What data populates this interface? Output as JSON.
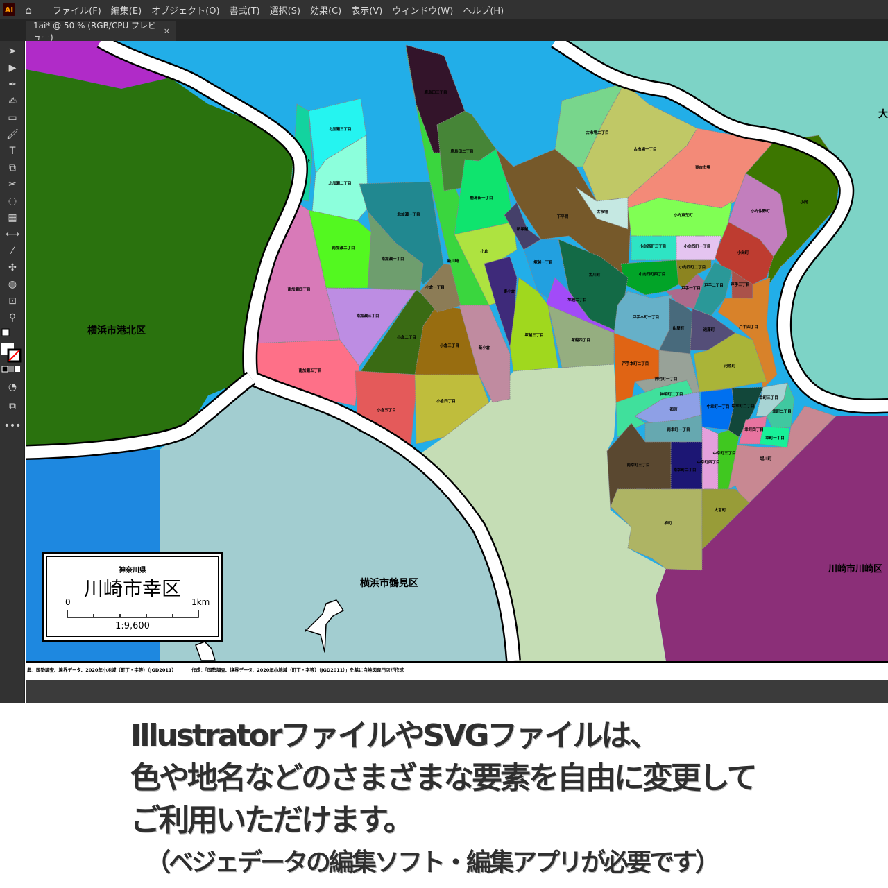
{
  "app": {
    "logo": "Ai",
    "home_icon": "home-icon"
  },
  "menu": [
    "ファイル(F)",
    "編集(E)",
    "オブジェクト(O)",
    "書式(T)",
    "選択(S)",
    "効果(C)",
    "表示(V)",
    "ウィンドウ(W)",
    "ヘルプ(H)"
  ],
  "tab": {
    "title": "1ai* @ 50 % (RGB/CPU プレビュー)",
    "close": "×"
  },
  "tools": [
    "selection",
    "direct-selection",
    "pen",
    "curvature",
    "rectangle",
    "paintbrush",
    "type",
    "scale",
    "scissors",
    "lasso",
    "gradient",
    "width",
    "eyedropper",
    "puppet-warp",
    "shape-builder",
    "artboard",
    "zoom"
  ],
  "map": {
    "areas": {
      "kohoku": "横浜市港北区",
      "tsurumi": "横浜市鶴見区",
      "kawasaki": "川崎市川崎区",
      "ota": "大"
    },
    "colors": {
      "sea": "#22aee8",
      "purple_tl": "#b02bc8",
      "kohoku": "#2a720e",
      "tsurumi_a": "#1e88e0",
      "tsurumi_b": "#a2cdd0",
      "kawasaki_green": "#c5ddb5",
      "kawasaki_ku": "#8b2f78",
      "ota": "#7dd3c6"
    },
    "districts": [
      {
        "name": "矢上",
        "color": "#13d39f"
      },
      {
        "name": "北加瀬三丁目",
        "color": "#25f4f0"
      },
      {
        "name": "北加瀬二丁目",
        "color": "#8cffdc"
      },
      {
        "name": "北加瀬一丁目",
        "color": "#218890"
      },
      {
        "name": "南加瀬二丁目",
        "color": "#53f820"
      },
      {
        "name": "南加瀬一丁目",
        "color": "#6e9e6e"
      },
      {
        "name": "南加瀬四丁目",
        "color": "#d87ab8"
      },
      {
        "name": "南加瀬三丁目",
        "color": "#bd8de3"
      },
      {
        "name": "南加瀬五丁目",
        "color": "#fe7088"
      },
      {
        "name": "小倉五丁目",
        "color": "#e45a5a"
      },
      {
        "name": "小倉四丁目",
        "color": "#bfbd3c"
      },
      {
        "name": "小倉二丁目",
        "color": "#3a6b14"
      },
      {
        "name": "小倉三丁目",
        "color": "#986d10"
      },
      {
        "name": "小倉一丁目",
        "color": "#8c7c56"
      },
      {
        "name": "新川崎",
        "color": "#3ad63e"
      },
      {
        "name": "鹿島田三丁目",
        "color": "#33142a"
      },
      {
        "name": "鹿島田二丁目",
        "color": "#468537"
      },
      {
        "name": "鹿島田一丁目",
        "color": "#0fe46e"
      },
      {
        "name": "小倉",
        "color": "#aee340"
      },
      {
        "name": "新小倉",
        "color": "#c08ba0"
      },
      {
        "name": "東小倉",
        "color": "#3e2a7a"
      },
      {
        "name": "新塚越",
        "color": "#45406a"
      },
      {
        "name": "下平間",
        "color": "#76592a"
      },
      {
        "name": "古市場二丁目",
        "color": "#78d68c"
      },
      {
        "name": "古市場一丁目",
        "color": "#c0c866"
      },
      {
        "name": "古市場",
        "color": "#c5e8e2"
      },
      {
        "name": "東古市場",
        "color": "#f38a78"
      },
      {
        "name": "小向",
        "color": "#3c7600"
      },
      {
        "name": "小向仲野町",
        "color": "#c27ebd"
      },
      {
        "name": "小向町",
        "color": "#be3c30"
      },
      {
        "name": "小向東芝町",
        "color": "#80ff54"
      },
      {
        "name": "小向西町三丁目",
        "color": "#2ee4c4"
      },
      {
        "name": "小向西町一丁目",
        "color": "#e4c4f0"
      },
      {
        "name": "小向西町四丁目",
        "color": "#02a428"
      },
      {
        "name": "小向西町二丁目",
        "color": "#8c8420"
      },
      {
        "name": "戸手一丁目",
        "color": "#ad6a8c"
      },
      {
        "name": "戸手二丁目",
        "color": "#2a9898"
      },
      {
        "name": "戸手三丁目",
        "color": "#aa524a"
      },
      {
        "name": "戸手四丁目",
        "color": "#d8822a"
      },
      {
        "name": "古川町",
        "color": "#136a46"
      },
      {
        "name": "塚越一丁目",
        "color": "#22a0e0"
      },
      {
        "name": "塚越二丁目",
        "color": "#a24bf8"
      },
      {
        "name": "塚越三丁目",
        "color": "#a0d81e"
      },
      {
        "name": "塚越四丁目",
        "color": "#95ae80"
      },
      {
        "name": "戸手本町一丁目",
        "color": "#66b0c8"
      },
      {
        "name": "紺屋町",
        "color": "#486a7c"
      },
      {
        "name": "遠藤町",
        "color": "#544e78"
      },
      {
        "name": "戸手本町二丁目",
        "color": "#e06414"
      },
      {
        "name": "河原町",
        "color": "#aab438"
      },
      {
        "name": "神明町一丁目",
        "color": "#98a298"
      },
      {
        "name": "神明町二丁目",
        "color": "#40e09c"
      },
      {
        "name": "都町",
        "color": "#8ea0e6"
      },
      {
        "name": "南幸町一丁目",
        "color": "#66a8b0"
      },
      {
        "name": "中幸町一丁目",
        "color": "#0070f0"
      },
      {
        "name": "中幸町二丁目",
        "color": "#12473a"
      },
      {
        "name": "幸町三丁目",
        "color": "#a8d4d4"
      },
      {
        "name": "幸町二丁目",
        "color": "#40c8a0"
      },
      {
        "name": "幸町四丁目",
        "color": "#e874a0"
      },
      {
        "name": "幸町一丁目",
        "color": "#18f098"
      },
      {
        "name": "堀川町",
        "color": "#c88892"
      },
      {
        "name": "中幸町三丁目",
        "color": "#40c820"
      },
      {
        "name": "中幸町四丁目",
        "color": "#e4a0dc"
      },
      {
        "name": "南幸町二丁目",
        "color": "#1c1674"
      },
      {
        "name": "南幸町三丁目",
        "color": "#5a4830"
      },
      {
        "name": "柳町",
        "color": "#aeb464"
      },
      {
        "name": "大宮町",
        "color": "#989c38"
      }
    ]
  },
  "legend": {
    "pref": "神奈川県",
    "title": "川崎市幸区",
    "zero": "0",
    "km": "1km",
    "scale": "1:9,600"
  },
  "footer": {
    "source": "典：国勢調査、境界データ、2020年小地域（町丁・字等）（JGD2011）",
    "credit": "作成：「国勢調査、境界データ、2020年小地域（町丁・字等）（JGD2011）」を基に白地図専門店が作成"
  },
  "caption": [
    "IllustratorファイルやSVGファイルは、",
    "色や地名などのさまざまな要素を自由に変更して",
    "ご利用いただけます。",
    "（ベジェデータの編集ソフト・編集アプリが必要です）"
  ]
}
